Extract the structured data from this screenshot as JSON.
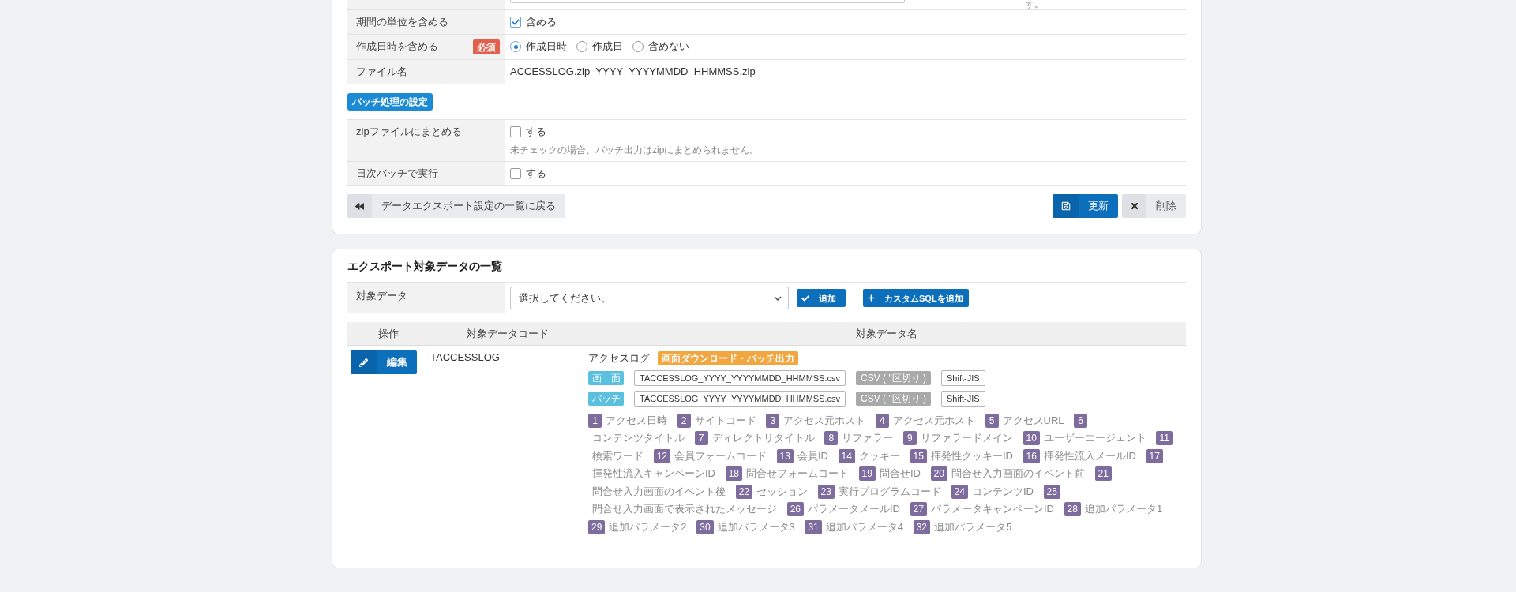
{
  "partial_row": {
    "note": "す。"
  },
  "settings": [
    {
      "label": "期間の単位を含める",
      "kind": "checkbox",
      "options": [
        {
          "label": "含める",
          "checked": true
        }
      ]
    },
    {
      "label": "作成日時を含める",
      "required": "必須",
      "kind": "radio",
      "options": [
        {
          "label": "作成日時",
          "selected": true
        },
        {
          "label": "作成日",
          "selected": false
        },
        {
          "label": "含めない",
          "selected": false
        }
      ]
    },
    {
      "label": "ファイル名",
      "kind": "text",
      "value": "ACCESSLOG.zip_YYYY_YYYYMMDD_HHMMSS.zip"
    }
  ],
  "batch": {
    "heading": "バッチ処理の設定",
    "rows": [
      {
        "label": "zipファイルにまとめる",
        "kind": "checkbox",
        "options": [
          {
            "label": "する",
            "checked": false
          }
        ],
        "hint": "未チェックの場合、バッチ出力はzipにまとめられません。"
      },
      {
        "label": "日次バッチで実行",
        "kind": "checkbox",
        "options": [
          {
            "label": "する",
            "checked": false
          }
        ]
      }
    ]
  },
  "actions": {
    "back": "データエクスポート設定の一覧に戻る",
    "update": "更新",
    "delete": "削除"
  },
  "export_list": {
    "title": "エクスポート対象データの一覧",
    "target": {
      "label": "対象データ",
      "value": "選択してください。",
      "add": "追加",
      "add_sql": "カスタムSQLを追加"
    },
    "table": {
      "columns": [
        "操作",
        "対象データコード",
        "対象データ名"
      ],
      "rows": [
        {
          "action": "編集",
          "code": "TACCESSLOG",
          "name": "アクセスログ",
          "tag": "画面ダウンロード・バッチ出力",
          "outputs": [
            {
              "type": "画　面",
              "filename": "TACCESSLOG_YYYY_YYYYMMDD_HHMMSS.csv",
              "format": "CSV ( \"区切り )",
              "encoding": "Shift-JIS"
            },
            {
              "type": "バッチ",
              "filename": "TACCESSLOG_YYYY_YYYYMMDD_HHMMSS.csv",
              "format": "CSV ( \"区切り )",
              "encoding": "Shift-JIS"
            }
          ],
          "fields": [
            {
              "number": "1",
              "name": "アクセス日時"
            },
            {
              "number": "2",
              "name": "サイトコード"
            },
            {
              "number": "3",
              "name": "アクセス元ホスト"
            },
            {
              "number": "4",
              "name": "アクセス元ホスト"
            },
            {
              "number": "5",
              "name": "アクセスURL"
            },
            {
              "number": "6",
              "name": "コンテンツタイトル"
            },
            {
              "number": "7",
              "name": "ディレクトリタイトル"
            },
            {
              "number": "8",
              "name": "リファラー"
            },
            {
              "number": "9",
              "name": "リファラードメイン"
            },
            {
              "number": "10",
              "name": "ユーザーエージェント"
            },
            {
              "number": "11",
              "name": "検索ワード"
            },
            {
              "number": "12",
              "name": "会員フォームコード"
            },
            {
              "number": "13",
              "name": "会員ID"
            },
            {
              "number": "14",
              "name": "クッキー"
            },
            {
              "number": "15",
              "name": "揮発性クッキーID"
            },
            {
              "number": "16",
              "name": "揮発性流入メールID"
            },
            {
              "number": "17",
              "name": "揮発性流入キャンペーンID"
            },
            {
              "number": "18",
              "name": "問合せフォームコード"
            },
            {
              "number": "19",
              "name": "問合せID"
            },
            {
              "number": "20",
              "name": "問合せ入力画面のイベント前"
            },
            {
              "number": "21",
              "name": "問合せ入力画面のイベント後"
            },
            {
              "number": "22",
              "name": "セッション"
            },
            {
              "number": "23",
              "name": "実行プログラムコード"
            },
            {
              "number": "24",
              "name": "コンテンツID"
            },
            {
              "number": "25",
              "name": "問合せ入力画面で表示されたメッセージ"
            },
            {
              "number": "26",
              "name": "パラメータメールID"
            },
            {
              "number": "27",
              "name": "パラメータキャンペーンID"
            },
            {
              "number": "28",
              "name": "追加パラメータ1"
            },
            {
              "number": "29",
              "name": "追加パラメータ2"
            },
            {
              "number": "30",
              "name": "追加パラメータ3"
            },
            {
              "number": "31",
              "name": "追加パラメータ4"
            },
            {
              "number": "32",
              "name": "追加パラメータ5"
            }
          ]
        }
      ]
    }
  }
}
